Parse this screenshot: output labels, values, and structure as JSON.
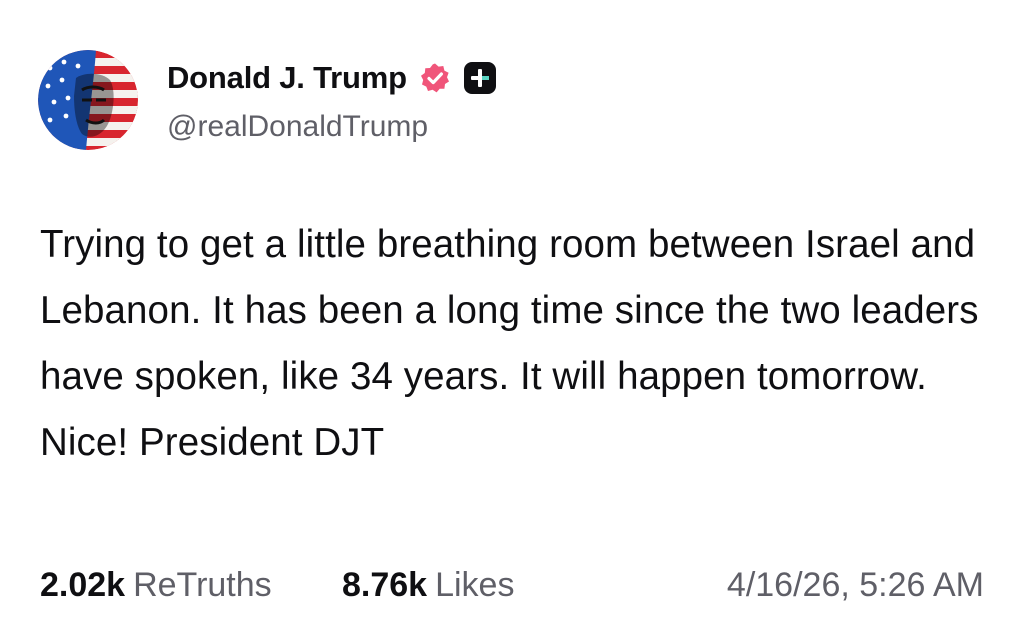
{
  "author": {
    "display_name": "Donald J. Trump",
    "handle": "@realDonaldTrump",
    "avatar_icon": "flag-portrait-avatar",
    "verified_icon": "verified-badge-icon",
    "verified_color": "#f0557a",
    "plus_icon": "plus-badge-icon"
  },
  "post": {
    "text": "Trying to get a little breathing room between Israel and Lebanon. It has been a long time since the two leaders have spoken, like 34 years. It will happen tomorrow. Nice! President DJT"
  },
  "stats": {
    "retruths_count": "2.02k",
    "retruths_label": "ReTruths",
    "likes_count": "8.76k",
    "likes_label": "Likes"
  },
  "timestamp": "4/16/26, 5:26 AM",
  "colors": {
    "text": "#0f0f12",
    "muted": "#5f5f67",
    "background": "#ffffff"
  }
}
